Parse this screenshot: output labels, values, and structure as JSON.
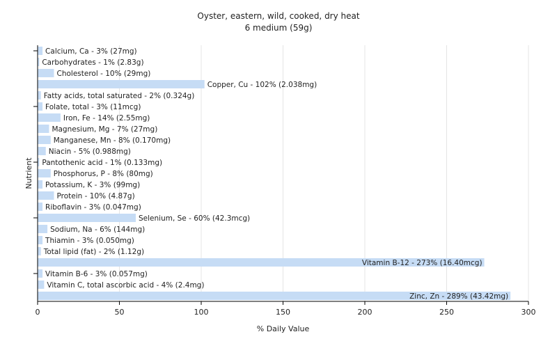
{
  "chart_data": {
    "type": "bar",
    "orientation": "horizontal",
    "title": "Oyster, eastern, wild, cooked, dry heat",
    "subtitle": "6 medium (59g)",
    "xlabel": "% Daily Value",
    "ylabel": "Nutrient",
    "xlim": [
      0,
      300
    ],
    "xticks": [
      0,
      50,
      100,
      150,
      200,
      250,
      300
    ],
    "grid": true,
    "legend": "none",
    "bar_color": "#c6dcf5",
    "categories": [
      "Calcium, Ca",
      "Carbohydrates",
      "Cholesterol",
      "Copper, Cu",
      "Fatty acids, total saturated",
      "Folate, total",
      "Iron, Fe",
      "Magnesium, Mg",
      "Manganese, Mn",
      "Niacin",
      "Pantothenic acid",
      "Phosphorus, P",
      "Potassium, K",
      "Protein",
      "Riboflavin",
      "Selenium, Se",
      "Sodium, Na",
      "Thiamin",
      "Total lipid (fat)",
      "Vitamin B-12",
      "Vitamin B-6",
      "Vitamin C, total ascorbic acid",
      "Zinc, Zn"
    ],
    "values": [
      3,
      1,
      10,
      102,
      2,
      3,
      14,
      7,
      8,
      5,
      1,
      8,
      3,
      10,
      3,
      60,
      6,
      3,
      2,
      273,
      3,
      4,
      289
    ],
    "labels": [
      "Calcium, Ca - 3% (27mg)",
      "Carbohydrates - 1% (2.83g)",
      "Cholesterol - 10% (29mg)",
      "Copper, Cu - 102% (2.038mg)",
      "Fatty acids, total saturated - 2% (0.324g)",
      "Folate, total - 3% (11mcg)",
      "Iron, Fe - 14% (2.55mg)",
      "Magnesium, Mg - 7% (27mg)",
      "Manganese, Mn - 8% (0.170mg)",
      "Niacin - 5% (0.988mg)",
      "Pantothenic acid - 1% (0.133mg)",
      "Phosphorus, P - 8% (80mg)",
      "Potassium, K - 3% (99mg)",
      "Protein - 10% (4.87g)",
      "Riboflavin - 3% (0.047mg)",
      "Selenium, Se - 60% (42.3mcg)",
      "Sodium, Na - 6% (144mg)",
      "Thiamin - 3% (0.050mg)",
      "Total lipid (fat) - 2% (1.12g)",
      "Vitamin B-12 - 273% (16.40mcg)",
      "Vitamin B-6 - 3% (0.057mg)",
      "Vitamin C, total ascorbic acid - 4% (2.4mg)",
      "Zinc, Zn - 289% (43.42mg)"
    ],
    "inside_label_categories": [
      "Vitamin B-12",
      "Zinc, Zn"
    ]
  }
}
